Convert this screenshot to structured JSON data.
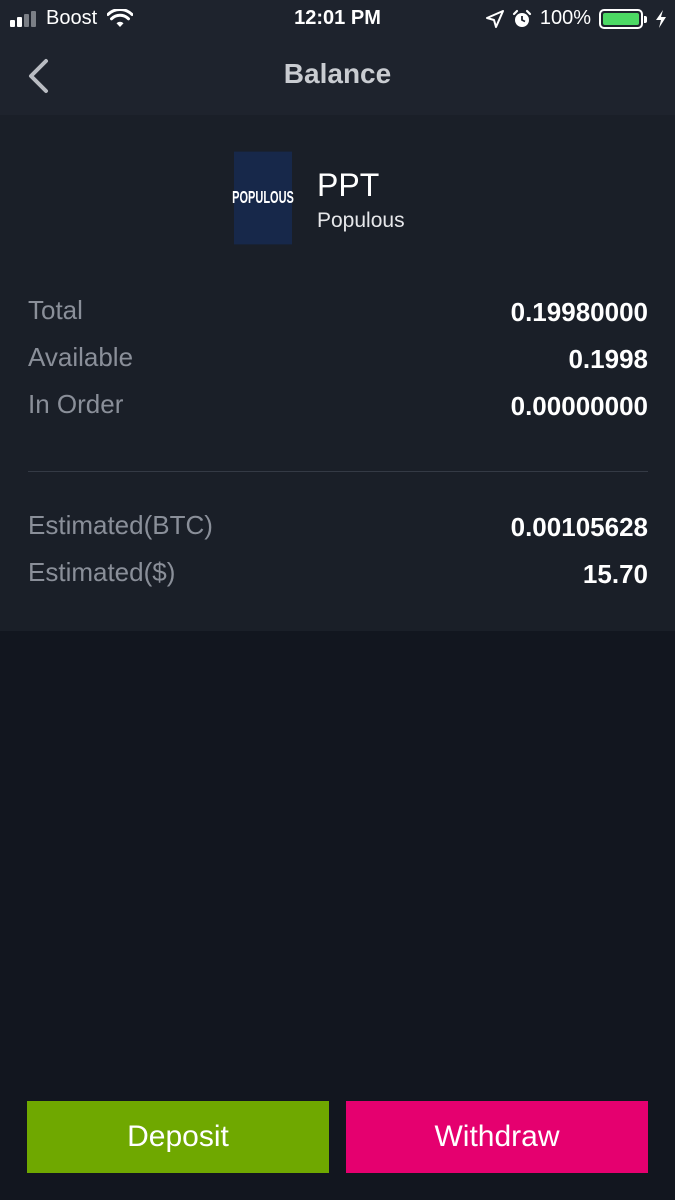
{
  "status_bar": {
    "carrier": "Boost",
    "time": "12:01 PM",
    "battery_percent": "100%",
    "battery_color": "#4cd964",
    "signal_bars_filled": 2,
    "signal_bars_total": 4
  },
  "nav": {
    "title": "Balance",
    "back_icon": "chevron-left-icon"
  },
  "coin": {
    "logo_text": "POPULOUS",
    "symbol": "PPT",
    "name": "Populous"
  },
  "balances": [
    {
      "label": "Total",
      "value": "0.19980000"
    },
    {
      "label": "Available",
      "value": "0.1998"
    },
    {
      "label": "In Order",
      "value": "0.00000000"
    }
  ],
  "estimates": [
    {
      "label": "Estimated(BTC)",
      "value": "0.00105628"
    },
    {
      "label": "Estimated($)",
      "value": "15.70"
    }
  ],
  "actions": {
    "deposit_label": "Deposit",
    "withdraw_label": "Withdraw",
    "deposit_color": "#6fa800",
    "withdraw_color": "#e5006f"
  }
}
